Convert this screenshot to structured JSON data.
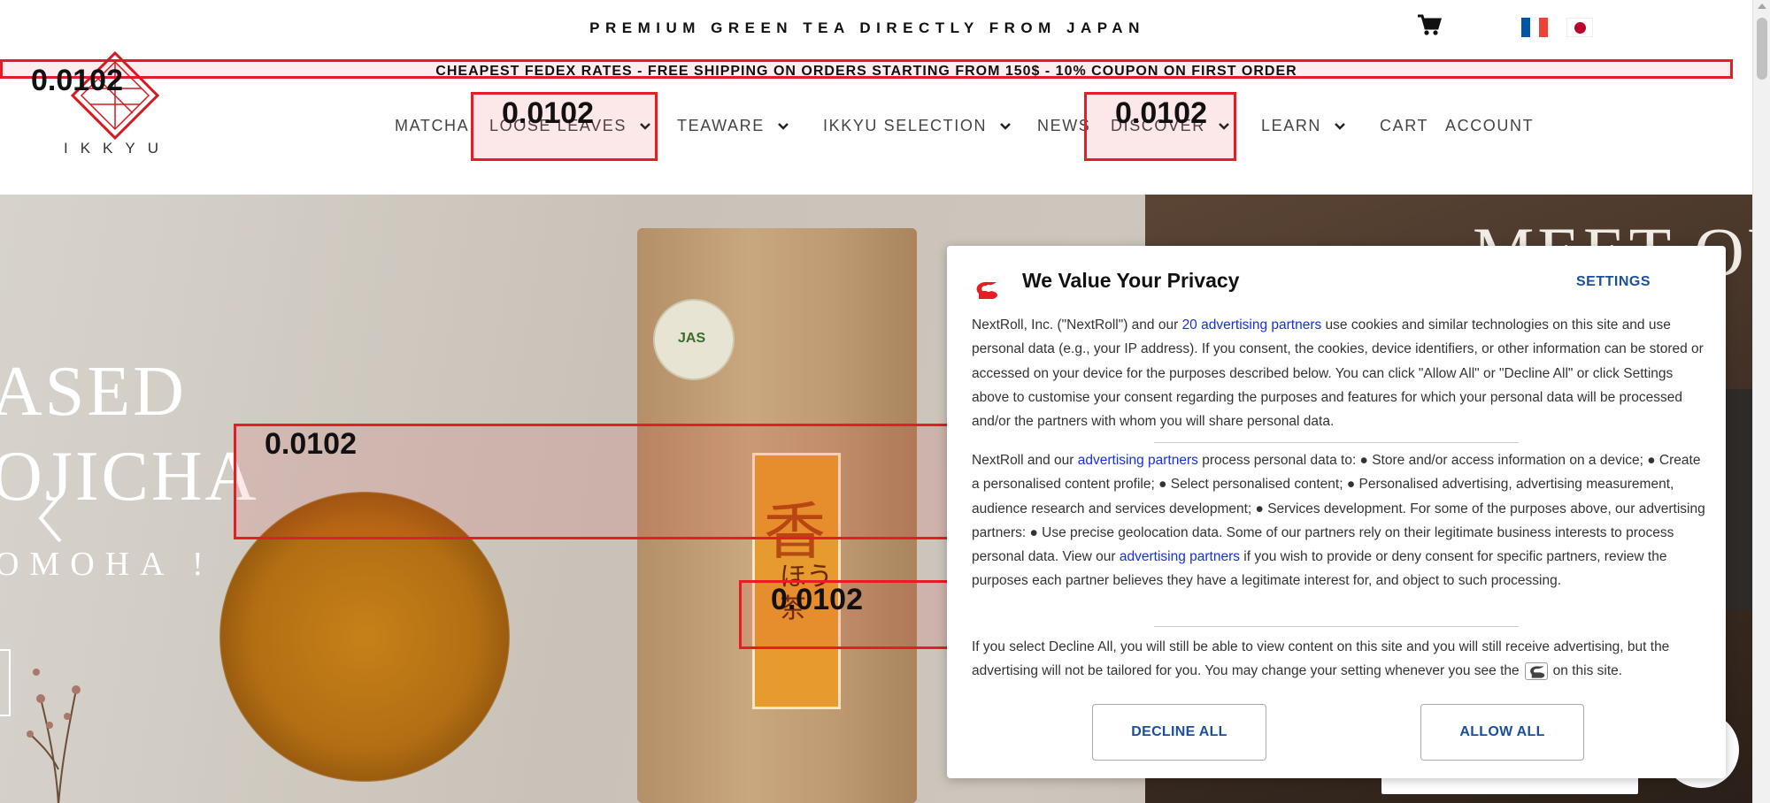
{
  "header": {
    "tagline": "PREMIUM GREEN TEA DIRECTLY FROM JAPAN",
    "shipping_banner": "CHEAPEST FEDEX RATES - FREE SHIPPING ON ORDERS STARTING FROM 150$ - 10% COUPON ON FIRST ORDER",
    "logo_text": "IKKYU",
    "icons": {
      "cart": "cart-icon",
      "flag_fr": "flag-france-icon",
      "flag_jp": "flag-japan-icon"
    }
  },
  "nav": {
    "items": [
      {
        "label": "MATCHA",
        "dropdown": false
      },
      {
        "label": "LOOSE LEAVES",
        "dropdown": true
      },
      {
        "label": "TEAWARE",
        "dropdown": true
      },
      {
        "label": "IKKYU SELECTION",
        "dropdown": true
      },
      {
        "label": "NEWS",
        "dropdown": false
      },
      {
        "label": "DISCOVER",
        "dropdown": true
      },
      {
        "label": "LEARN",
        "dropdown": true
      },
      {
        "label": "CART",
        "dropdown": false
      },
      {
        "label": "ACCOUNT",
        "dropdown": false
      }
    ]
  },
  "overlay": {
    "score_label": "0.0102"
  },
  "hero": {
    "title_line1": "ASED",
    "title_line2": "OJICHA",
    "subtitle": "OMOHA !",
    "right_heading": "MEET OU",
    "bag_glyph": "香",
    "bag_glyph_small": "ほう\n茶",
    "seal_text": "JAS"
  },
  "privacy": {
    "title": "We Value Your Privacy",
    "settings_label": "SETTINGS",
    "p1_text": "NextRoll, Inc. (\"NextRoll\") and our ",
    "p1_link": "20 advertising partners",
    "p1_rest": " use cookies and similar technologies on this site and use personal data (e.g., your IP address). If you consent, the cookies, device identifiers, or other information can be stored or accessed on your device for the purposes described below. You can click \"Allow All\" or \"Decline All\" or click Settings above to customise your consent regarding the purposes and features for which your personal data will be processed and/or the partners with whom you will share personal data.",
    "p2_text": "NextRoll and our ",
    "p2_link": "advertising partners",
    "p2_rest": " process personal data to: ● Store and/or access information on a device; ● Create a personalised content profile; ● Select personalised content; ● Personalised advertising, advertising measurement, audience research and services development; ● Services development. For some of the purposes above, our advertising partners: ● Use precise geolocation data. Some of our partners rely on their legitimate business interests to process personal data. View our ",
    "p2_link2": "advertising partners",
    "p2_rest2": " if you wish to provide or deny consent for specific partners, review the purposes each partner believes they have a legitimate interest for, and object to such processing.",
    "p3_text": "If you select Decline All, you will still be able to view content on this site and you will still receive advertising, but the advertising will not be tailored for you. You may change your setting whenever you see the",
    "p3_rest": "on this site.",
    "decline_label": "DECLINE ALL",
    "allow_label": "ALLOW ALL",
    "colors": {
      "link": "#1530e0",
      "button_text": "#1a4f9e",
      "brand": "#e51d24"
    }
  },
  "colors": {
    "marker": "#e51d24"
  }
}
